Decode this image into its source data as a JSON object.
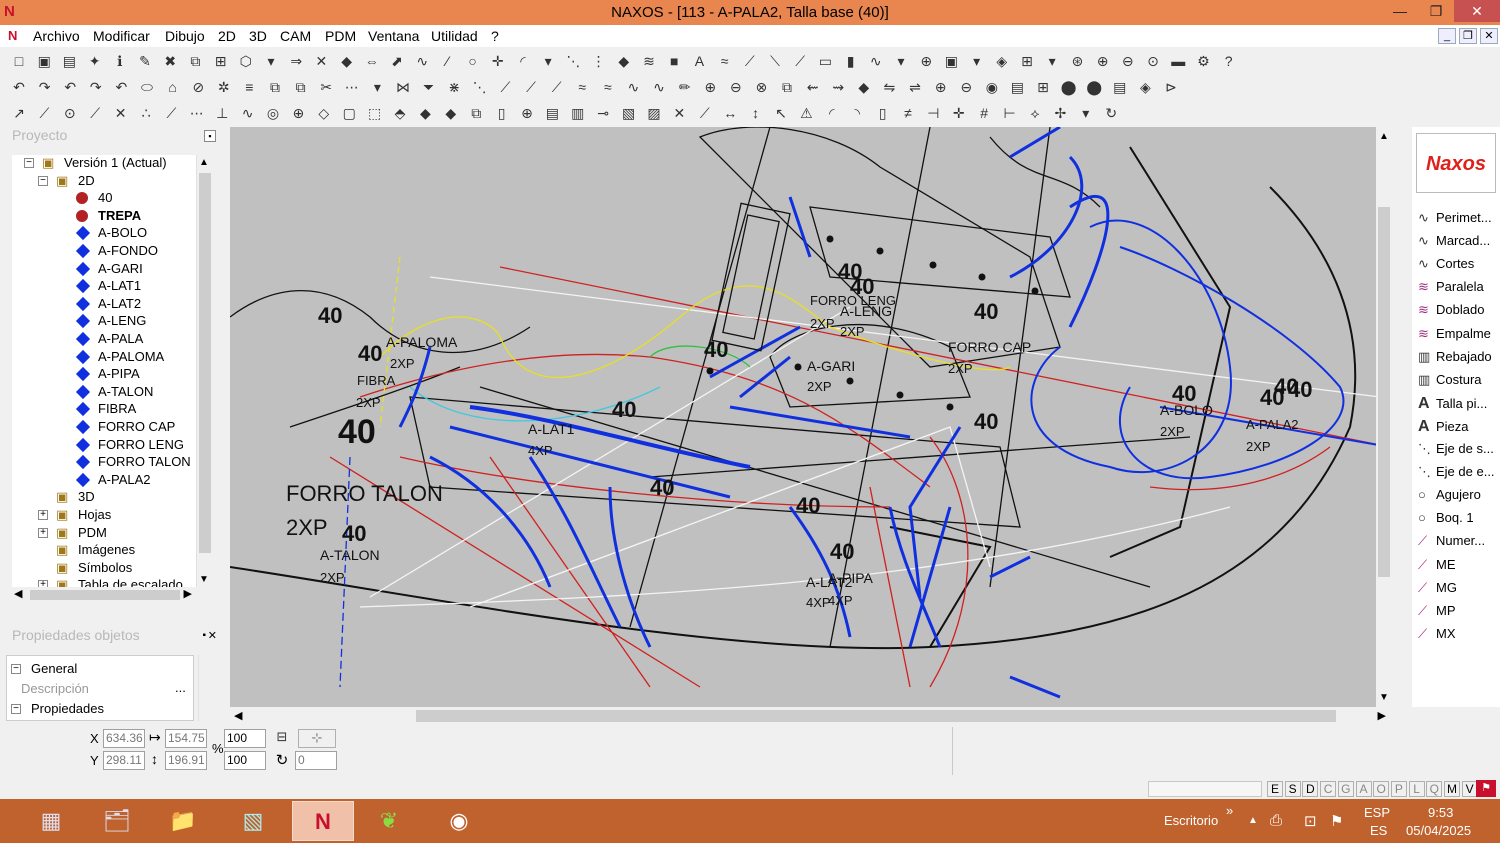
{
  "window": {
    "title": "NAXOS - [113 - A-PALA2, Talla base (40)]",
    "minimize": "—",
    "restore": "❐",
    "close": "✕"
  },
  "menu": {
    "items": [
      "Archivo",
      "Modificar",
      "Dibujo",
      "2D",
      "3D",
      "CAM",
      "PDM",
      "Ventana",
      "Utilidad",
      "?"
    ]
  },
  "project_panel": {
    "title": "Proyecto",
    "tree": [
      {
        "label": "Versión 1 (Actual)",
        "icon": "project-icon"
      },
      {
        "label": "2D",
        "icon": "folder-2d-icon"
      },
      {
        "label": "40",
        "icon": "size-dot-icon"
      },
      {
        "label": "TREPA",
        "icon": "size-dot-icon",
        "bold": true
      },
      {
        "label": "A-BOLO",
        "icon": "piece-diamond-icon"
      },
      {
        "label": "A-FONDO",
        "icon": "piece-diamond-icon"
      },
      {
        "label": "A-GARI",
        "icon": "piece-diamond-icon"
      },
      {
        "label": "A-LAT1",
        "icon": "piece-diamond-icon"
      },
      {
        "label": "A-LAT2",
        "icon": "piece-diamond-icon"
      },
      {
        "label": "A-LENG",
        "icon": "piece-diamond-icon"
      },
      {
        "label": "A-PALA",
        "icon": "piece-diamond-icon"
      },
      {
        "label": "A-PALOMA",
        "icon": "piece-diamond-icon"
      },
      {
        "label": "A-PIPA",
        "icon": "piece-diamond-icon"
      },
      {
        "label": "A-TALON",
        "icon": "piece-diamond-icon"
      },
      {
        "label": "FIBRA",
        "icon": "piece-diamond-icon"
      },
      {
        "label": "FORRO CAP",
        "icon": "piece-diamond-icon"
      },
      {
        "label": "FORRO LENG",
        "icon": "piece-diamond-icon"
      },
      {
        "label": "FORRO TALON",
        "icon": "piece-diamond-icon"
      },
      {
        "label": "A-PALA2",
        "icon": "piece-diamond-icon"
      },
      {
        "label": "3D",
        "icon": "folder-3d-icon"
      },
      {
        "label": "Hojas",
        "icon": "sheets-icon"
      },
      {
        "label": "PDM",
        "icon": "pdm-folder-icon"
      },
      {
        "label": "Imágenes",
        "icon": "images-icon"
      },
      {
        "label": "Símbolos",
        "icon": "symbols-icon"
      },
      {
        "label": "Tabla de escalado",
        "icon": "scale-table-icon"
      }
    ]
  },
  "properties_panel": {
    "title": "Propiedades objetos",
    "general": "General",
    "descripcion": "Descripción",
    "ellipsis": "...",
    "propiedades": "Propiedades"
  },
  "canvas": {
    "labels": [
      "40",
      "A-PALOMA",
      "40",
      "2XP",
      "FIBRA",
      "2XP",
      "40",
      "A-LAT1",
      "4XP",
      "40",
      "FORRO TALON",
      "2XP",
      "40",
      "A-TALON",
      "2XP",
      "40",
      "40",
      "FORRO LENG",
      "2XP",
      "A-LENG",
      "2XP",
      "40",
      "40",
      "A-GARI",
      "2XP",
      "40",
      "FORRO CAP",
      "2XP",
      "40",
      "40",
      "40",
      "A-BOLO",
      "2XP",
      "40",
      "40",
      "A-PALA2",
      "2XP",
      "40",
      "40",
      "A-LAT2",
      "A-PIPA",
      "4XP",
      "4XP"
    ]
  },
  "right_panel": {
    "logo": "Naxos",
    "items": [
      {
        "label": "Perimet...",
        "icon": "perimeter-icon"
      },
      {
        "label": "Marcad...",
        "icon": "marker-icon"
      },
      {
        "label": "Cortes",
        "icon": "cuts-icon"
      },
      {
        "label": "Paralela",
        "icon": "parallel-icon"
      },
      {
        "label": "Doblado",
        "icon": "fold-icon"
      },
      {
        "label": "Empalme",
        "icon": "join-icon"
      },
      {
        "label": "Rebajado",
        "icon": "skive-icon"
      },
      {
        "label": "Costura",
        "icon": "seam-icon"
      },
      {
        "label": "Talla pi...",
        "icon": "text-a-icon"
      },
      {
        "label": "Pieza",
        "icon": "text-a-icon"
      },
      {
        "label": "Eje de s...",
        "icon": "axis-icon"
      },
      {
        "label": "Eje de e...",
        "icon": "axis-icon"
      },
      {
        "label": "Agujero",
        "icon": "hole-icon"
      },
      {
        "label": "Boq. 1",
        "icon": "hole-icon"
      },
      {
        "label": "Numer...",
        "icon": "number-icon"
      },
      {
        "label": "ME",
        "icon": "mark-icon"
      },
      {
        "label": "MG",
        "icon": "mark-icon"
      },
      {
        "label": "MP",
        "icon": "mark-icon"
      },
      {
        "label": "MX",
        "icon": "mark-icon"
      }
    ]
  },
  "status": {
    "x_label": "X",
    "y_label": "Y",
    "x": "634.36",
    "y": "298.11",
    "width": "154.75",
    "height": "196.91",
    "scale_x": "100",
    "scale_y": "100",
    "percent": "%",
    "angle": "0"
  },
  "mode_keys": [
    "E",
    "S",
    "D",
    "C",
    "G",
    "A",
    "O",
    "P",
    "L",
    "Q",
    "M",
    "V"
  ],
  "taskbar": {
    "desktop": "Escritorio",
    "chevron": "»",
    "lang_top": "ESP",
    "lang_bottom": "ES",
    "time": "9:53",
    "date": "05/04/2025"
  },
  "colors": {
    "titlebar": "#e9854f",
    "taskbar": "#c0622e",
    "canvas": "#c0c0c0",
    "piece_blue": "#1030e0",
    "size_red": "#b22222"
  }
}
